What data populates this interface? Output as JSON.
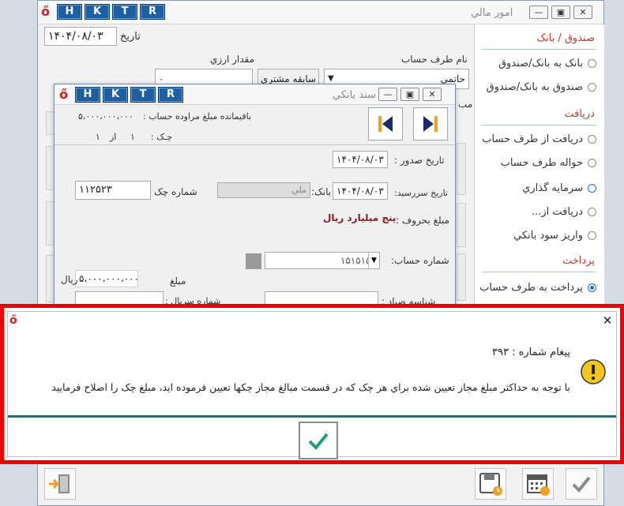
{
  "hotkeys": [
    "H",
    "K",
    "T",
    "R"
  ],
  "main_window": {
    "title": "امور مالي",
    "date_label": "تاريخ",
    "date_value": "۱۴۰۴/۰۸/۰۳",
    "counterparty_label": "نام طرف حساب",
    "counterparty_value": "حاتمي",
    "currency_amount_label": "مقدار ارزي",
    "currency_amount_value": "۰",
    "customer_history_button": "سابقه مشتري",
    "partial_label": "مب"
  },
  "right_panel": {
    "sections": [
      {
        "title": "صندوق / بانک",
        "items": [
          {
            "label": "بانک به بانک/صندوق",
            "selected": false
          },
          {
            "label": "صندوق به بانک/صندوق",
            "selected": false
          }
        ]
      },
      {
        "title": "دريافت",
        "items": [
          {
            "label": "دريافت از طرف حساب",
            "selected": false
          },
          {
            "label": "حواله طرف حساب",
            "selected": false
          },
          {
            "label": "سرمايه گذاري",
            "selected": false
          },
          {
            "label": "دريافت از...",
            "selected": false
          },
          {
            "label": "واريز سود بانکي",
            "selected": false
          }
        ]
      },
      {
        "title": "پرداخت",
        "items": [
          {
            "label": "پرداخت به طرف حساب",
            "selected": true
          }
        ]
      }
    ]
  },
  "sanad_window": {
    "title": "سند بانکي",
    "remaining_label": "باقيمانده مبلغ مراوده حساب  :",
    "remaining_value": "۵،۰۰۰،۰۰۰،۰۰۰",
    "check_label": "چـک   :",
    "check_index": "۱",
    "of_label": "از",
    "check_total": "۱",
    "issue_date_label": "تاريخ صدور  :",
    "issue_date_value": "۱۴۰۴/۰۸/۰۳",
    "due_date_label": "تاريخ سررسيد:",
    "due_date_value": "۱۴۰۴/۰۸/۰۳",
    "bank_label": "بانک:",
    "bank_value": "ملي",
    "check_number_label": "شماره چک",
    "check_number_value": "۱۱۲۵۲۳",
    "amount_words_label": "مبلغ بحروف  :",
    "amount_words_value": "پنج ميليارد  ريال",
    "account_number_label": "شماره حساب:",
    "account_number_value": "۱۵۱۵۱۵۱",
    "amount_label": "مبلغ",
    "amount_value": "۵،۰۰۰،۰۰۰،۰۰۰",
    "amount_unit": "ريال",
    "serial_label": "شماره سريال :",
    "sayad_label": "شناسه صياد  :"
  },
  "alert": {
    "message_number": "پيغام شماره : ۳۹۳",
    "message": "با توجه به حداکثر مبلغ مجاز تعيين شده براي هر چک که در قسمت مبالغ مجاز چکها تعيين فرموده ايد، مبلغ چک را اصلاح فرماييد"
  },
  "colors": {
    "alert_border": "#f20000",
    "hotkey_blue": "#1d5fa3",
    "section_title": "#c0392b",
    "amount_words": "#8b1a1a",
    "divider_teal": "#2f6b6b",
    "ok_check": "#1aa36f",
    "warning_yellow": "#f5c518"
  }
}
